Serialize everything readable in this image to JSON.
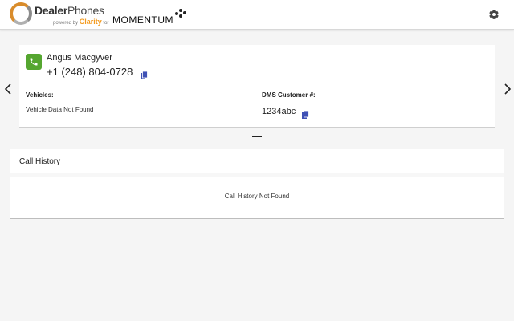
{
  "header": {
    "brand_bold": "Dealer",
    "brand_light": "Phones",
    "powered_by": "powered by",
    "partner": "Clarity",
    "for_text": "for",
    "product": "MOMENTUM",
    "settings_icon": "gear-icon"
  },
  "navigation": {
    "prev_icon": "chevron-left-icon",
    "next_icon": "chevron-right-icon"
  },
  "customer": {
    "name": "Angus Macgyver",
    "phone": "+1 (248) 804-0728",
    "vehicles_label": "Vehicles:",
    "vehicles_value": "Vehicle Data Not Found",
    "dms_label": "DMS Customer #:",
    "dms_value": "1234abc",
    "phone_badge_color": "#55a630",
    "copy_icon_color": "#3f51b5"
  },
  "call_history": {
    "title": "Call History",
    "empty_message": "Call History Not Found"
  }
}
